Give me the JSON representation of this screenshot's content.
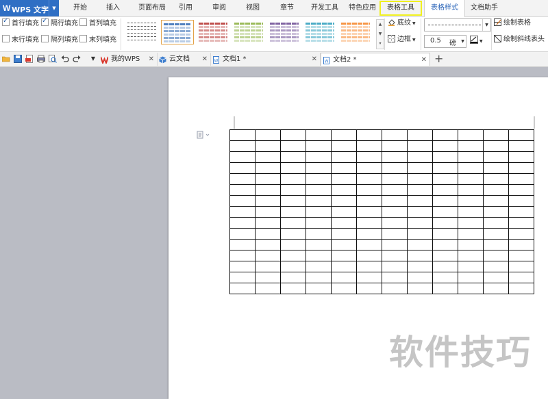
{
  "app": {
    "name": "WPS 文字"
  },
  "menu_tabs": [
    {
      "id": "home",
      "label": "开始"
    },
    {
      "id": "insert",
      "label": "插入"
    },
    {
      "id": "layout",
      "label": "页面布局"
    },
    {
      "id": "reference",
      "label": "引用"
    },
    {
      "id": "review",
      "label": "审阅"
    },
    {
      "id": "view",
      "label": "视图"
    },
    {
      "id": "section",
      "label": "章节"
    },
    {
      "id": "dev",
      "label": "开发工具"
    },
    {
      "id": "special",
      "label": "特色应用"
    },
    {
      "id": "table_tools",
      "label": "表格工具"
    },
    {
      "id": "table_style",
      "label": "表格样式",
      "active": true
    },
    {
      "id": "doc_helper",
      "label": "文档助手"
    }
  ],
  "ribbon": {
    "options": {
      "header_fill": {
        "label": "首行填充",
        "checked": true
      },
      "banded_rows": {
        "label": "隔行填充",
        "checked": true
      },
      "first_col": {
        "label": "首列填充",
        "checked": false
      },
      "last_row": {
        "label": "末行填充",
        "checked": false
      },
      "banded_cols": {
        "label": "隔列填充",
        "checked": false
      },
      "last_col": {
        "label": "末列填充",
        "checked": false
      }
    },
    "shading_label": "底纹",
    "borders_label": "边框",
    "line_width_value": "0.5",
    "line_width_unit": "磅",
    "draw_table_label": "绘制表格",
    "draw_diagonal_label": "绘制斜线表头",
    "style_colors": [
      "#ffffff",
      "#4f7fbd",
      "#c0504d",
      "#9bbb59",
      "#8064a2",
      "#4bacc6",
      "#f79646"
    ]
  },
  "doc_tabs": [
    {
      "label": "我的WPS"
    },
    {
      "label": "云文档"
    },
    {
      "label": "文档1 *"
    },
    {
      "label": "文档2 *",
      "active": true
    }
  ],
  "document": {
    "table_rows": 15,
    "table_cols": 12
  },
  "watermark": "软件技巧"
}
